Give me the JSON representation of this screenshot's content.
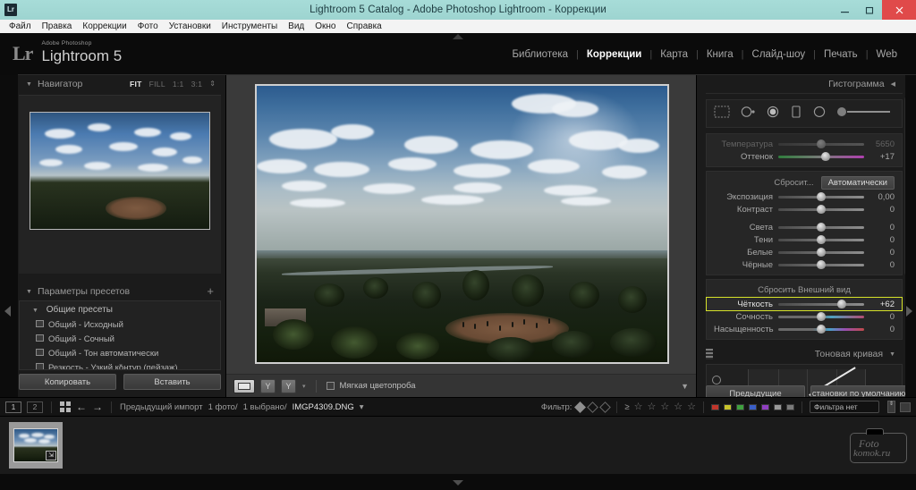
{
  "window": {
    "title": "Lightroom 5 Catalog - Adobe Photoshop Lightroom - Коррекции",
    "logo_text": "Lr",
    "minimize_icon": "minimize-icon",
    "maximize_icon": "restore-icon",
    "close_icon": "close-icon"
  },
  "menubar": {
    "items": [
      "Файл",
      "Правка",
      "Коррекции",
      "Фото",
      "Установки",
      "Инструменты",
      "Вид",
      "Окно",
      "Справка"
    ]
  },
  "identity": {
    "mark": "Lr",
    "super": "Adobe Photoshop",
    "name": "Lightroom 5"
  },
  "modules": {
    "items": [
      {
        "label": "Библиотека",
        "active": false
      },
      {
        "label": "Коррекции",
        "active": true
      },
      {
        "label": "Карта",
        "active": false
      },
      {
        "label": "Книга",
        "active": false
      },
      {
        "label": "Слайд-шоу",
        "active": false
      },
      {
        "label": "Печать",
        "active": false
      },
      {
        "label": "Web",
        "active": false
      }
    ],
    "separator": "|"
  },
  "navigator": {
    "title": "Навигатор",
    "collapse_caret": "▼",
    "zoom_levels": [
      {
        "label": "FIT",
        "active": true
      },
      {
        "label": "FILL",
        "active": false
      },
      {
        "label": "1:1",
        "active": false
      },
      {
        "label": "3:1",
        "active": false
      }
    ],
    "spinner": "⇕"
  },
  "presets": {
    "title": "Параметры пресетов",
    "add_label": "+",
    "collapse_caret": "▼",
    "group": "Общие пресеты",
    "items": [
      "Общий - Исходный",
      "Общий - Сочный",
      "Общий - Тон автоматически",
      "Резкость - Узкий контур (пейзаж)"
    ]
  },
  "left_buttons": {
    "copy": "Копировать",
    "paste": "Вставить"
  },
  "center_toolbar": {
    "view_icon": "loupe-view-icon",
    "before_after_left": "Y",
    "before_after_right": "Y",
    "dropdown_caret": "▾",
    "softproof_label": "Мягкая цветопроба",
    "softproof_checked": false,
    "collapse_caret": "▼"
  },
  "right_panel": {
    "histogram": {
      "title": "Гистограмма",
      "collapse_caret": "◀",
      "tools": [
        "crop-overlay-icon",
        "spot-removal-icon",
        "red-eye-icon",
        "graduated-filter-icon",
        "radial-filter-icon",
        "adjustment-brush-icon"
      ]
    },
    "basic": {
      "wb_rows": [
        {
          "label": "Температура",
          "value": "5650",
          "clipped": true,
          "knob_pct": 50,
          "track": "temp"
        },
        {
          "label": "Оттенок",
          "value": "+17",
          "clipped": false,
          "knob_pct": 55,
          "track": "tint"
        }
      ],
      "tone_reset_label": "Сбросит...",
      "auto_label": "Автоматически",
      "tone_rows": [
        {
          "label": "Экспозиция",
          "value": "0,00",
          "knob_pct": 50,
          "track": "plain"
        },
        {
          "label": "Контраст",
          "value": "0",
          "knob_pct": 50,
          "track": "plain"
        },
        {
          "label": "Света",
          "value": "0",
          "knob_pct": 50,
          "track": "plain"
        },
        {
          "label": "Тени",
          "value": "0",
          "knob_pct": 50,
          "track": "plain"
        },
        {
          "label": "Белые",
          "value": "0",
          "knob_pct": 50,
          "track": "plain"
        },
        {
          "label": "Чёрные",
          "value": "0",
          "knob_pct": 50,
          "track": "plain"
        }
      ],
      "presence_label": "Сбросить Внешний вид",
      "presence_rows": [
        {
          "label": "Чёткость",
          "value": "+62",
          "knob_pct": 74,
          "track": "plain",
          "highlighted": true
        },
        {
          "label": "Сочность",
          "value": "0",
          "knob_pct": 50,
          "track": "vib",
          "highlighted": false
        },
        {
          "label": "Насыщенность",
          "value": "0",
          "knob_pct": 50,
          "track": "sat",
          "highlighted": false
        }
      ]
    },
    "tone_curve": {
      "title": "Тоновая кривая",
      "collapse_caret": "▼",
      "target_icon": "target-adjust-icon",
      "region_icon": "curve-point-icon"
    },
    "buttons": {
      "previous": "Предыдущие",
      "reset": "становки по умолчанию."
    }
  },
  "filmstrip_bar": {
    "screen1": "1",
    "screen2": "2",
    "grid_icon": "grid-view-icon",
    "back_arrow": "←",
    "forward_arrow": "→",
    "source": "Предыдущий импорт",
    "count": "1 фото/",
    "selected": "1 выбрано/",
    "filename": "IMGP4309.DNG",
    "file_caret": "▾",
    "filter_label": "Фильтр:",
    "flags": [
      "flag-pick-icon",
      "flag-none-icon",
      "flag-reject-icon"
    ],
    "rating_prefix": "≥",
    "stars": [
      "☆",
      "☆",
      "☆",
      "☆",
      "☆"
    ],
    "color_swatches": [
      "#c0352b",
      "#c8c32b",
      "#3fa03f",
      "#3a5fc8",
      "#8f3fc0",
      "#9a9a9a",
      "#7a7a7a"
    ],
    "filter_select": "Фильтра нет",
    "filter_spinner": "⇕",
    "filter_end_icon": "filter-toggle-icon"
  },
  "filmstrip": {
    "thumb_badge": "⇲",
    "thumb_name": "thumbnail-IMGP4309"
  },
  "watermark": {
    "line1": "Foto",
    "line2": "komok.ru"
  },
  "colors": {
    "titlebar": "#a7dcd8",
    "accent_highlight": "#d7e32a",
    "close_button": "#e04a4a",
    "panel_bg": "#1b1b1b",
    "center_bg": "#3a3a3a"
  }
}
